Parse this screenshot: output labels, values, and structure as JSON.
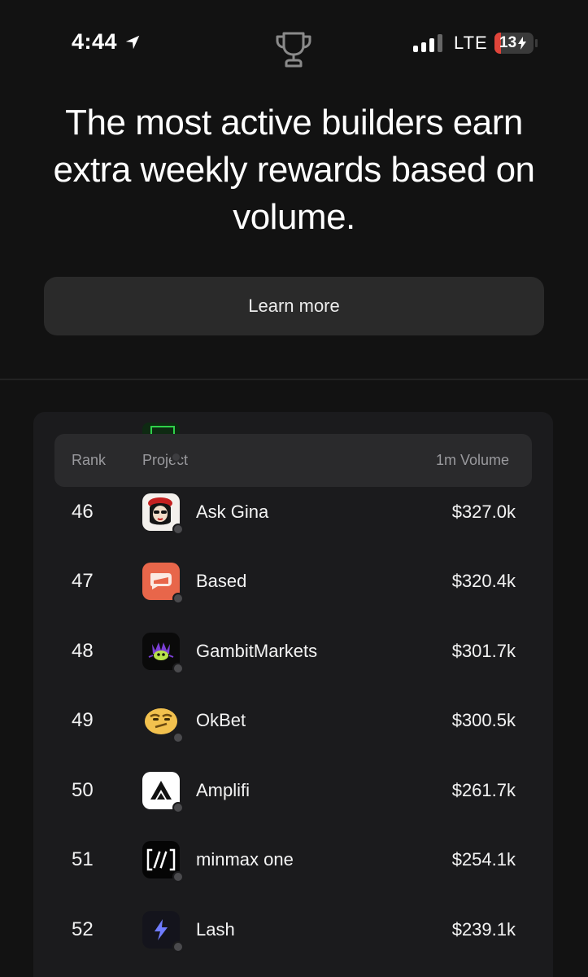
{
  "status": {
    "time": "4:44",
    "network": "LTE",
    "battery": "13",
    "icons": [
      "location-arrow-icon",
      "trophy-icon",
      "signal-icon",
      "battery-charging-icon"
    ]
  },
  "headline": "The most active builders earn extra weekly rewards based on volume.",
  "learn_more": "Learn more",
  "table": {
    "headers": {
      "rank": "Rank",
      "project": "Project",
      "volume": "1m Volume"
    },
    "rows": [
      {
        "rank": "46",
        "name": "Ask Gina",
        "volume": "$327.0k",
        "icon": "ask-gina-avatar-icon"
      },
      {
        "rank": "47",
        "name": "Based",
        "volume": "$320.4k",
        "icon": "based-logo-icon"
      },
      {
        "rank": "48",
        "name": "GambitMarkets",
        "volume": "$301.7k",
        "icon": "gambit-markets-logo-icon"
      },
      {
        "rank": "49",
        "name": "OkBet",
        "volume": "$300.5k",
        "icon": "okbet-logo-icon"
      },
      {
        "rank": "50",
        "name": "Amplifi",
        "volume": "$261.7k",
        "icon": "amplifi-logo-icon"
      },
      {
        "rank": "51",
        "name": "minmax one",
        "volume": "$254.1k",
        "icon": "minmax-logo-icon"
      },
      {
        "rank": "52",
        "name": "Lash",
        "volume": "$239.1k",
        "icon": "lash-logo-icon"
      }
    ]
  },
  "colors": {
    "background": "#121212",
    "card": "#1b1b1d",
    "header_row": "#2a2a2c",
    "button": "#2a2a2a",
    "muted_text": "#9a9a9e"
  }
}
